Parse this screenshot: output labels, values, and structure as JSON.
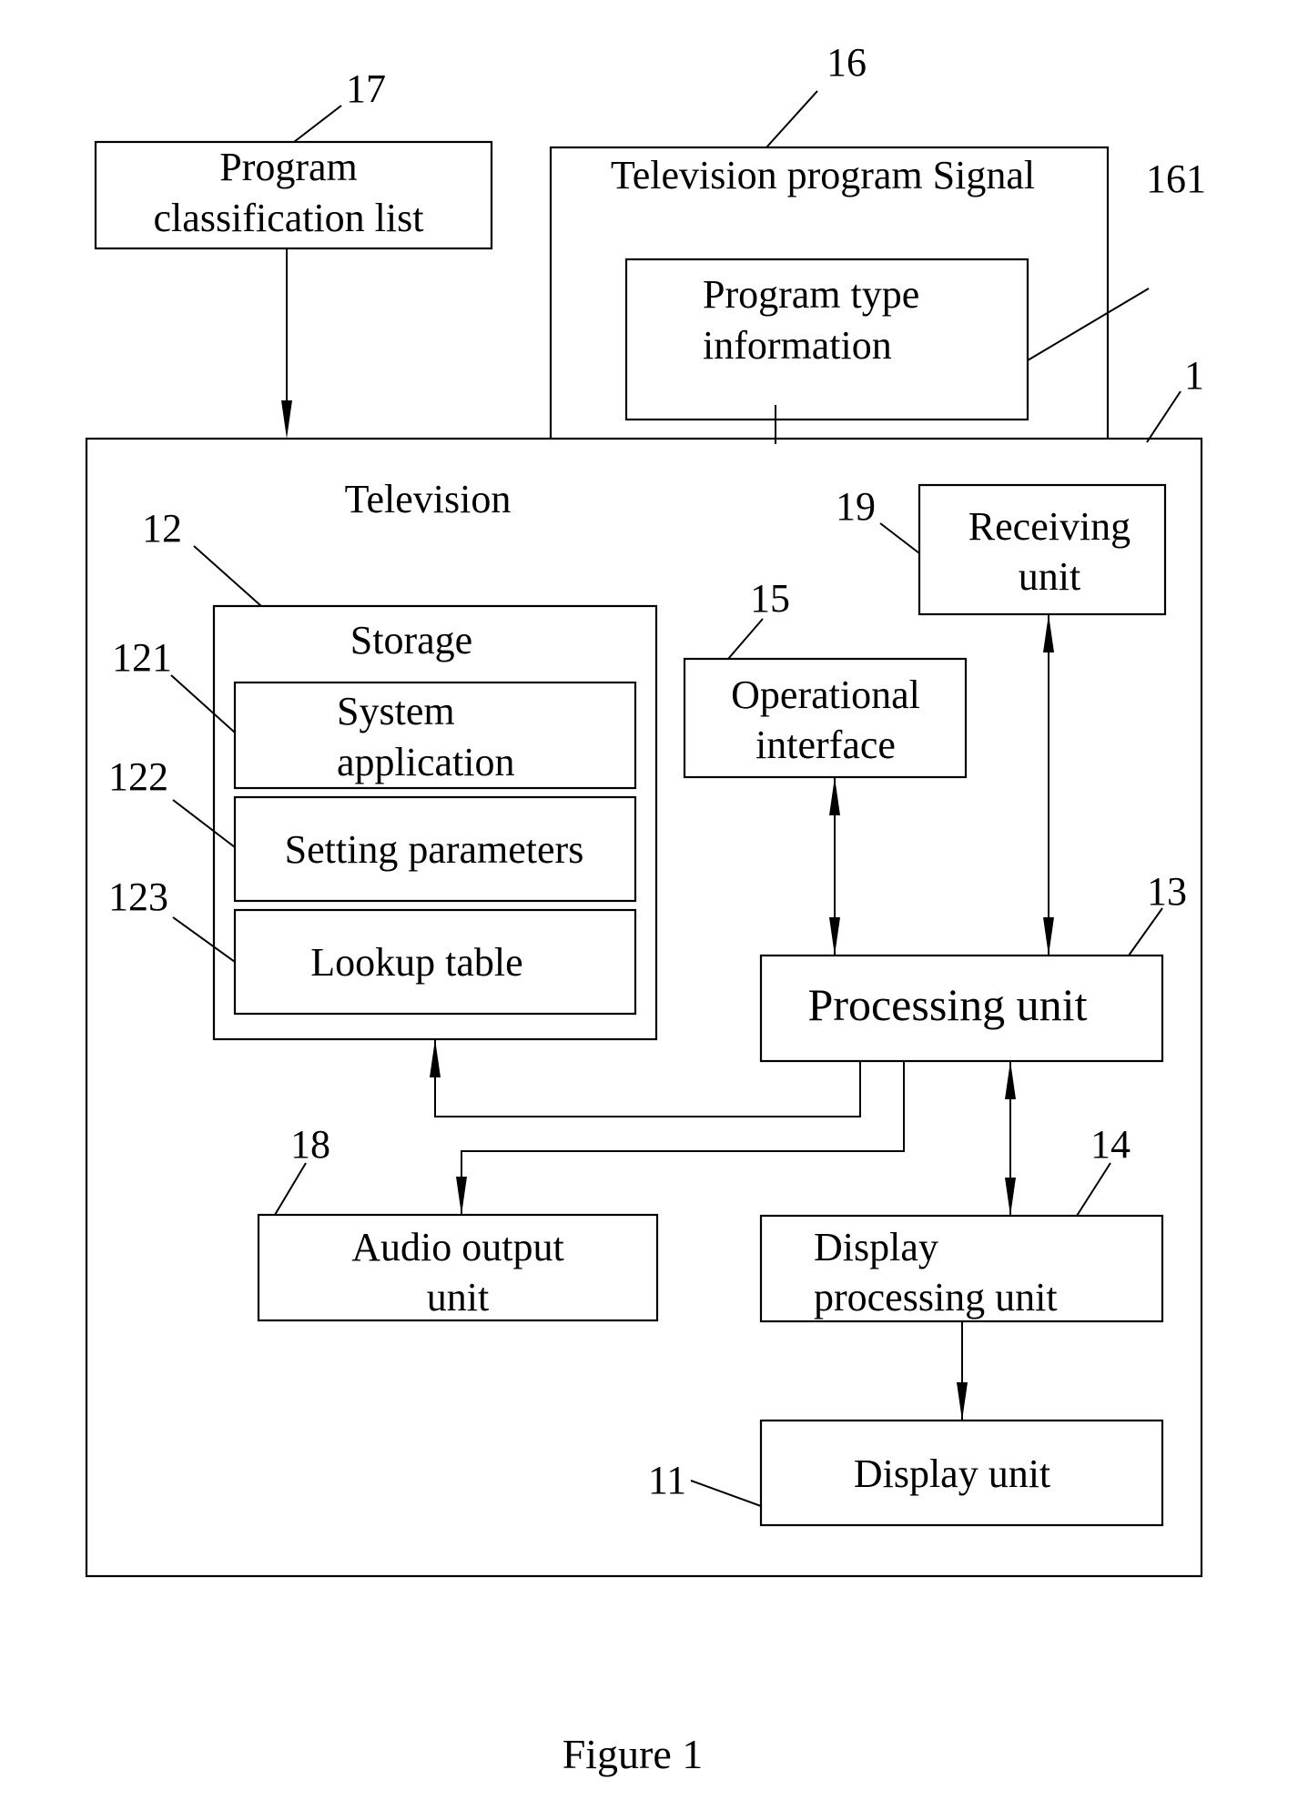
{
  "figure": {
    "caption": "Figure 1",
    "ink_color": "#000000",
    "background_color": "#ffffff"
  },
  "blocks": {
    "program_classification_list": {
      "ref": "17",
      "lines": [
        "Program",
        "classification list"
      ]
    },
    "tv_program_signal": {
      "ref": "16",
      "lines": [
        "Television program Signal"
      ]
    },
    "program_type_information": {
      "ref": "161",
      "lines": [
        "Program type",
        "information"
      ]
    },
    "television": {
      "ref": "1",
      "lines": [
        "Television"
      ]
    },
    "storage": {
      "ref": "12",
      "lines": [
        "Storage"
      ]
    },
    "system_application": {
      "ref": "121",
      "lines": [
        "System",
        "application"
      ]
    },
    "setting_parameters": {
      "ref": "122",
      "lines": [
        "Setting parameters"
      ]
    },
    "lookup_table": {
      "ref": "123",
      "lines": [
        "Lookup table"
      ]
    },
    "receiving_unit": {
      "ref": "19",
      "lines": [
        "Receiving",
        "unit"
      ]
    },
    "operational_interface": {
      "ref": "15",
      "lines": [
        "Operational",
        "interface"
      ]
    },
    "processing_unit": {
      "ref": "13",
      "lines": [
        "Processing unit"
      ]
    },
    "audio_output_unit": {
      "ref": "18",
      "lines": [
        "Audio output",
        "unit"
      ]
    },
    "display_processing_unit": {
      "ref": "14",
      "lines": [
        "Display",
        "processing unit"
      ]
    },
    "display_unit": {
      "ref": "11",
      "lines": [
        "Display unit"
      ]
    }
  },
  "connections": [
    {
      "from": "program_classification_list",
      "to": "television",
      "direction": "one-way"
    },
    {
      "from": "tv_program_signal",
      "to": "television",
      "direction": "one-way"
    },
    {
      "from": "operational_interface",
      "to": "processing_unit",
      "direction": "two-way"
    },
    {
      "from": "receiving_unit",
      "to": "processing_unit",
      "direction": "two-way"
    },
    {
      "from": "processing_unit",
      "to": "storage",
      "direction": "one-way"
    },
    {
      "from": "processing_unit",
      "to": "audio_output_unit",
      "direction": "one-way"
    },
    {
      "from": "processing_unit",
      "to": "display_processing_unit",
      "direction": "two-way"
    },
    {
      "from": "display_processing_unit",
      "to": "display_unit",
      "direction": "one-way"
    }
  ]
}
